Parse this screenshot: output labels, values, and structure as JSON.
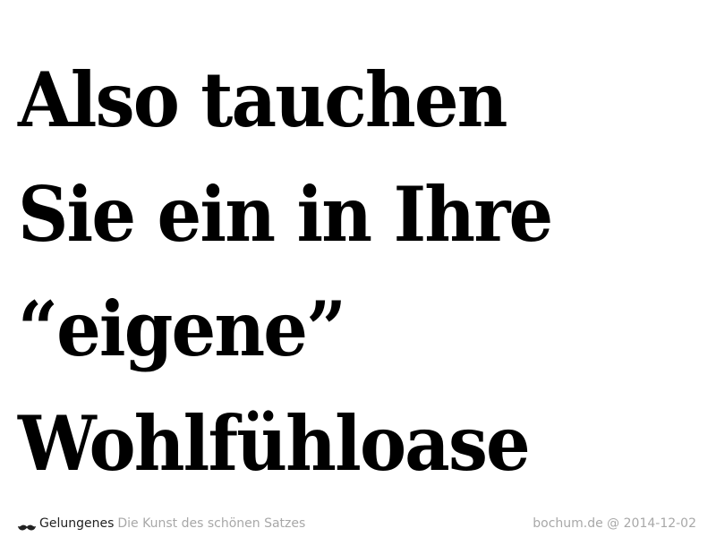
{
  "headline": {
    "lines": [
      "Also tauchen",
      "Sie ein in Ihre",
      "“eigene”",
      "Wohlfühloase"
    ]
  },
  "footer": {
    "icon": "mustache-icon",
    "brand": "Gelungenes",
    "tagline": "Die Kunst des schönen Satzes",
    "source": "bochum.de @ 2014-12-02"
  },
  "colors": {
    "text": "#000000",
    "muted": "#a8a8a8",
    "background": "#ffffff"
  }
}
